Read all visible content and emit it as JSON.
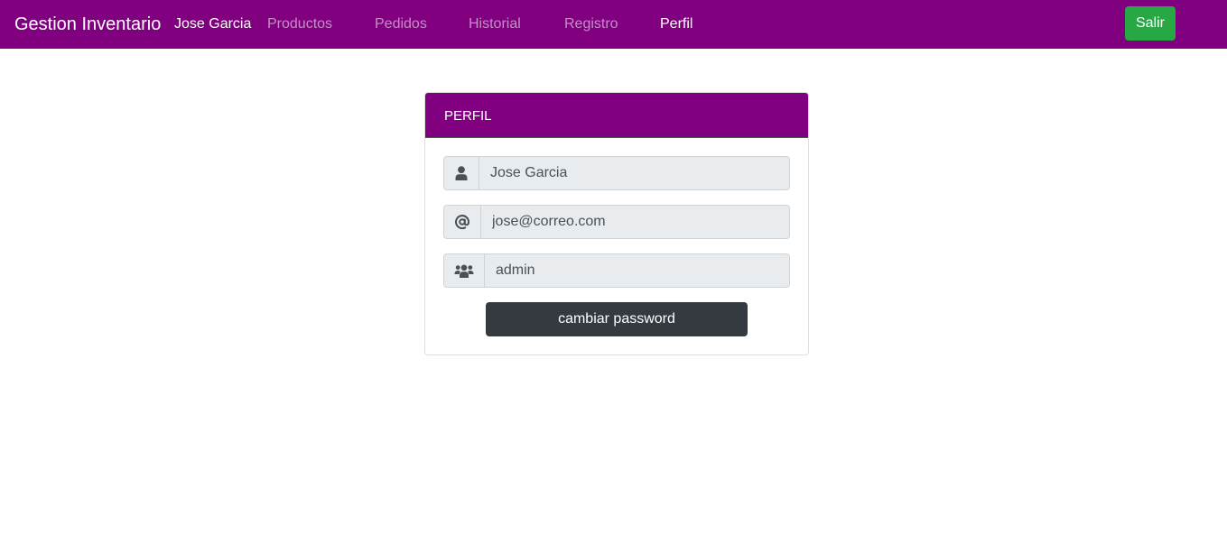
{
  "navbar": {
    "brand": "Gestion Inventario",
    "user_name": "Jose Garcia",
    "links": [
      {
        "label": "Productos",
        "active": false
      },
      {
        "label": "Pedidos",
        "active": false
      },
      {
        "label": "Historial",
        "active": false
      },
      {
        "label": "Registro",
        "active": false
      },
      {
        "label": "Perfil",
        "active": true
      }
    ],
    "logout_label": "Salir"
  },
  "profile": {
    "title": "PERFIL",
    "fields": [
      {
        "icon": "user-icon",
        "value": "Jose Garcia"
      },
      {
        "icon": "at-icon",
        "value": "jose@correo.com"
      },
      {
        "icon": "users-icon",
        "value": "admin"
      }
    ],
    "change_password_label": "cambiar password"
  },
  "colors": {
    "navbar_bg": "#800080",
    "card_header_bg": "#800080",
    "logout_button": "#28a745",
    "change_password_button": "#343a40",
    "input_bg": "#e9ecef"
  }
}
